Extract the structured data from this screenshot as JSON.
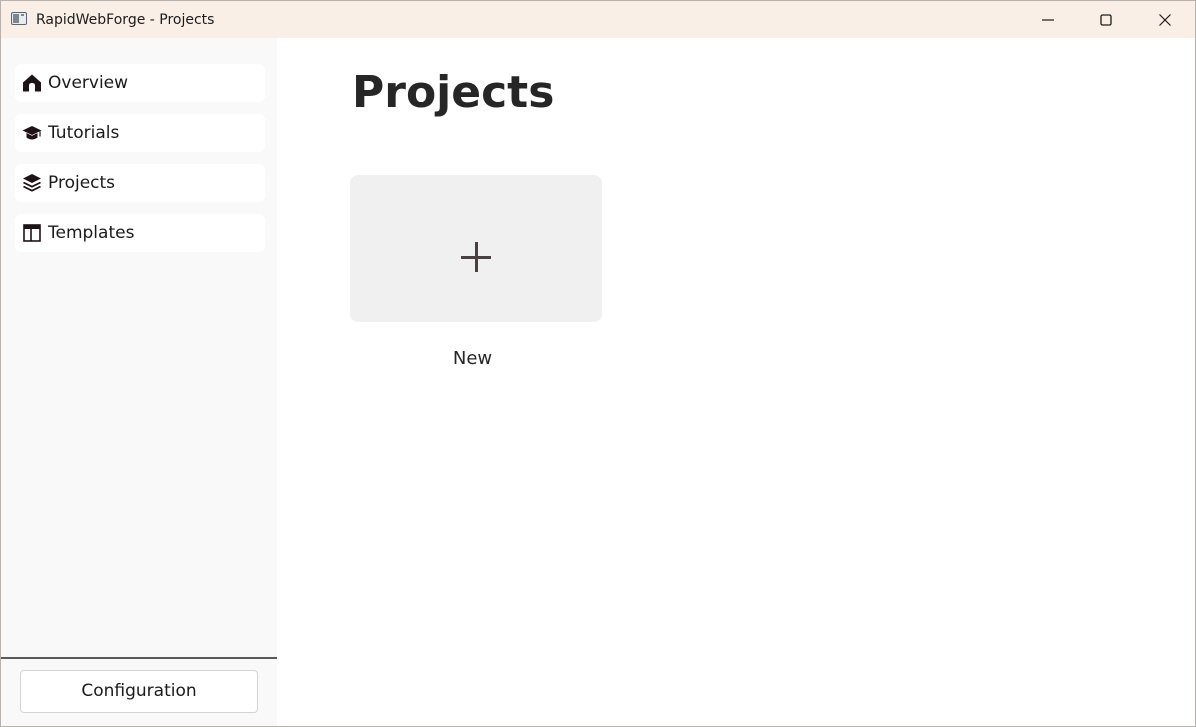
{
  "window": {
    "title": "RapidWebForge - Projects",
    "controls": {
      "minimize": "minimize-icon",
      "maximize": "maximize-icon",
      "close": "close-icon"
    }
  },
  "sidebar": {
    "items": [
      {
        "label": "Overview",
        "icon": "home-icon"
      },
      {
        "label": "Tutorials",
        "icon": "graduation-cap-icon"
      },
      {
        "label": "Projects",
        "icon": "layers-icon"
      },
      {
        "label": "Templates",
        "icon": "template-icon"
      }
    ],
    "config_button": "Configuration"
  },
  "main": {
    "title": "Projects",
    "tiles": [
      {
        "label": "New",
        "icon": "plus-icon"
      }
    ]
  },
  "colors": {
    "titlebar": "#f9efe6",
    "sidebar": "#f9f9f9",
    "tile": "#f0f0f0",
    "icon": "#1f1216"
  }
}
